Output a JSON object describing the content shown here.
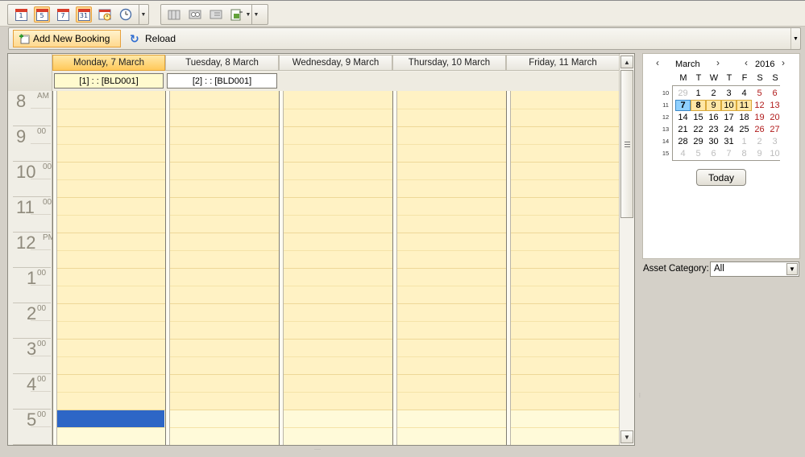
{
  "toolbar": {
    "view_buttons": [
      {
        "name": "day-view",
        "icon": "calendar-day-icon",
        "glyph": "1",
        "active": false
      },
      {
        "name": "work-week-view",
        "icon": "calendar-workweek-icon",
        "glyph": "5",
        "active": true
      },
      {
        "name": "week-view",
        "icon": "calendar-week-icon",
        "glyph": "7",
        "active": false
      },
      {
        "name": "month-view",
        "icon": "calendar-month-icon",
        "glyph": "31",
        "active": false
      },
      {
        "name": "timeline-view",
        "icon": "timeline-icon",
        "glyph": "",
        "active": false
      },
      {
        "name": "gantt-view",
        "icon": "clock-icon",
        "glyph": "",
        "active": false
      }
    ]
  },
  "actions": {
    "add_label": "Add New Booking",
    "reload_label": "Reload"
  },
  "scheduler": {
    "days": [
      {
        "label": "Monday, 7 March",
        "today": true
      },
      {
        "label": "Tuesday, 8 March",
        "today": false
      },
      {
        "label": "Wednesday, 9 March",
        "today": false
      },
      {
        "label": "Thursday, 10 March",
        "today": false
      },
      {
        "label": "Friday, 11 March",
        "today": false
      }
    ],
    "resources": [
      {
        "label": "[1] : :  [BLD001]",
        "selected": true
      },
      {
        "label": "[2] : :  [BLD001]",
        "selected": false
      }
    ],
    "hours": [
      {
        "num": "8",
        "sup": "AM"
      },
      {
        "num": "9",
        "sup": "00"
      },
      {
        "num": "10",
        "sup": "00"
      },
      {
        "num": "11",
        "sup": "00"
      },
      {
        "num": "12",
        "sup": "PM"
      },
      {
        "num": "1",
        "sup": "00"
      },
      {
        "num": "2",
        "sup": "00"
      },
      {
        "num": "3",
        "sup": "00"
      },
      {
        "num": "4",
        "sup": "00"
      },
      {
        "num": "5",
        "sup": "00"
      }
    ]
  },
  "mini_calendar": {
    "month": "March",
    "year": "2016",
    "weekdays": [
      "M",
      "T",
      "W",
      "T",
      "F",
      "S",
      "S"
    ],
    "weeks": [
      {
        "num": "10",
        "days": [
          "29",
          "1",
          "2",
          "3",
          "4",
          "5",
          "6"
        ]
      },
      {
        "num": "11",
        "days": [
          "7",
          "8",
          "9",
          "10",
          "11",
          "12",
          "13"
        ]
      },
      {
        "num": "12",
        "days": [
          "14",
          "15",
          "16",
          "17",
          "18",
          "19",
          "20"
        ]
      },
      {
        "num": "13",
        "days": [
          "21",
          "22",
          "23",
          "24",
          "25",
          "26",
          "27"
        ]
      },
      {
        "num": "14",
        "days": [
          "28",
          "29",
          "30",
          "31",
          "1",
          "2",
          "3"
        ]
      },
      {
        "num": "15",
        "days": [
          "4",
          "5",
          "6",
          "7",
          "8",
          "9",
          "10"
        ]
      }
    ],
    "today_label": "Today"
  },
  "filter": {
    "label": "Asset Category:",
    "value": "All"
  },
  "colors": {
    "work_hours": "#fff2c4",
    "selection": "#2d66c6",
    "today_header": "#ffc95a",
    "weekend_text": "#b01a1a"
  }
}
